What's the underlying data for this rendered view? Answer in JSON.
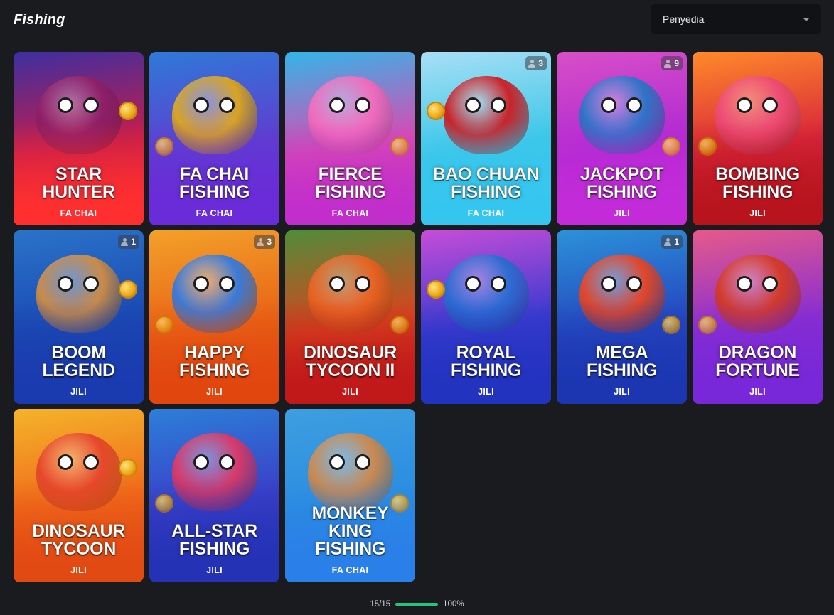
{
  "header": {
    "title": "Fishing",
    "provider_filter": {
      "selected": "Penyedia"
    }
  },
  "games": [
    {
      "title_lines": [
        "STAR",
        "HUNTER"
      ],
      "provider": "FA CHAI",
      "players": null,
      "colors": [
        "#3d2fa0",
        "#c21d4c",
        "#ff2f2f"
      ],
      "mascot": "#8e1f68"
    },
    {
      "title_lines": [
        "FA CHAI",
        "FISHING"
      ],
      "provider": "FA CHAI",
      "players": null,
      "colors": [
        "#2f79d8",
        "#5d3fd0",
        "#6a2bd8"
      ],
      "mascot": "#d8a325"
    },
    {
      "title_lines": [
        "FIERCE",
        "FISHING"
      ],
      "provider": "FA CHAI",
      "players": null,
      "colors": [
        "#32b6e8",
        "#d94bb2",
        "#c22ecb"
      ],
      "mascot": "#f06bbd"
    },
    {
      "title_lines": [
        "BAO CHUAN",
        "FISHING"
      ],
      "provider": "FA CHAI",
      "players": "3",
      "colors": [
        "#a8dff5",
        "#3cc7e8",
        "#35c6ef"
      ],
      "mascot": "#c9232a"
    },
    {
      "title_lines": [
        "JACKPOT",
        "FISHING"
      ],
      "provider": "JILI",
      "players": "9",
      "colors": [
        "#d84fc7",
        "#b02ad2",
        "#c32bd9"
      ],
      "mascot": "#2f73c8"
    },
    {
      "title_lines": [
        "BOMBING",
        "FISHING"
      ],
      "provider": "JILI",
      "players": null,
      "colors": [
        "#ff8a2a",
        "#d8263a",
        "#b8141e"
      ],
      "mascot": "#ee4a73"
    },
    {
      "title_lines": [
        "BOOM",
        "LEGEND"
      ],
      "provider": "JILI",
      "players": "1",
      "colors": [
        "#2a73c9",
        "#1a4ab2",
        "#1a3bb0"
      ],
      "mascot": "#c88b4a"
    },
    {
      "title_lines": [
        "HAPPY",
        "FISHING"
      ],
      "provider": "JILI",
      "players": "3",
      "colors": [
        "#f3a12a",
        "#e86516",
        "#e2460f"
      ],
      "mascot": "#3a7ad8"
    },
    {
      "title_lines": [
        "DINOSAUR",
        "TYCOON II"
      ],
      "provider": "JILI",
      "players": null,
      "colors": [
        "#4f8d3a",
        "#d8451e",
        "#c1181a"
      ],
      "mascot": "#e76221"
    },
    {
      "title_lines": [
        "ROYAL",
        "FISHING"
      ],
      "provider": "JILI",
      "players": null,
      "colors": [
        "#c64dd8",
        "#3a3ad0",
        "#2233c0"
      ],
      "mascot": "#2c6bd2"
    },
    {
      "title_lines": [
        "MEGA",
        "FISHING"
      ],
      "provider": "JILI",
      "players": "1",
      "colors": [
        "#2b92d8",
        "#2548c0",
        "#1c36b2"
      ],
      "mascot": "#e0462a"
    },
    {
      "title_lines": [
        "DRAGON",
        "FORTUNE"
      ],
      "provider": "JILI",
      "players": null,
      "colors": [
        "#e55a8a",
        "#8a2ed0",
        "#7828d8"
      ],
      "mascot": "#d23a2a"
    },
    {
      "title_lines": [
        "DINOSAUR",
        "TYCOON"
      ],
      "provider": "JILI",
      "players": null,
      "colors": [
        "#f4b42a",
        "#f06a1a",
        "#e24a14"
      ],
      "mascot": "#e6482a"
    },
    {
      "title_lines": [
        "ALL-STAR",
        "FISHING"
      ],
      "provider": "JILI",
      "players": null,
      "colors": [
        "#2c7fd8",
        "#3a3fc8",
        "#2432b6"
      ],
      "mascot": "#d63a6a"
    },
    {
      "title_lines": [
        "MONKEY",
        "KING",
        "FISHING"
      ],
      "provider": "FA CHAI",
      "players": null,
      "colors": [
        "#3e9ee0",
        "#2a8ee0",
        "#2b7fe8"
      ],
      "mascot": "#c98a52"
    }
  ],
  "footer": {
    "count": "15/15",
    "percent": "100%",
    "progress": 1.0,
    "accent": "#27c37a"
  }
}
